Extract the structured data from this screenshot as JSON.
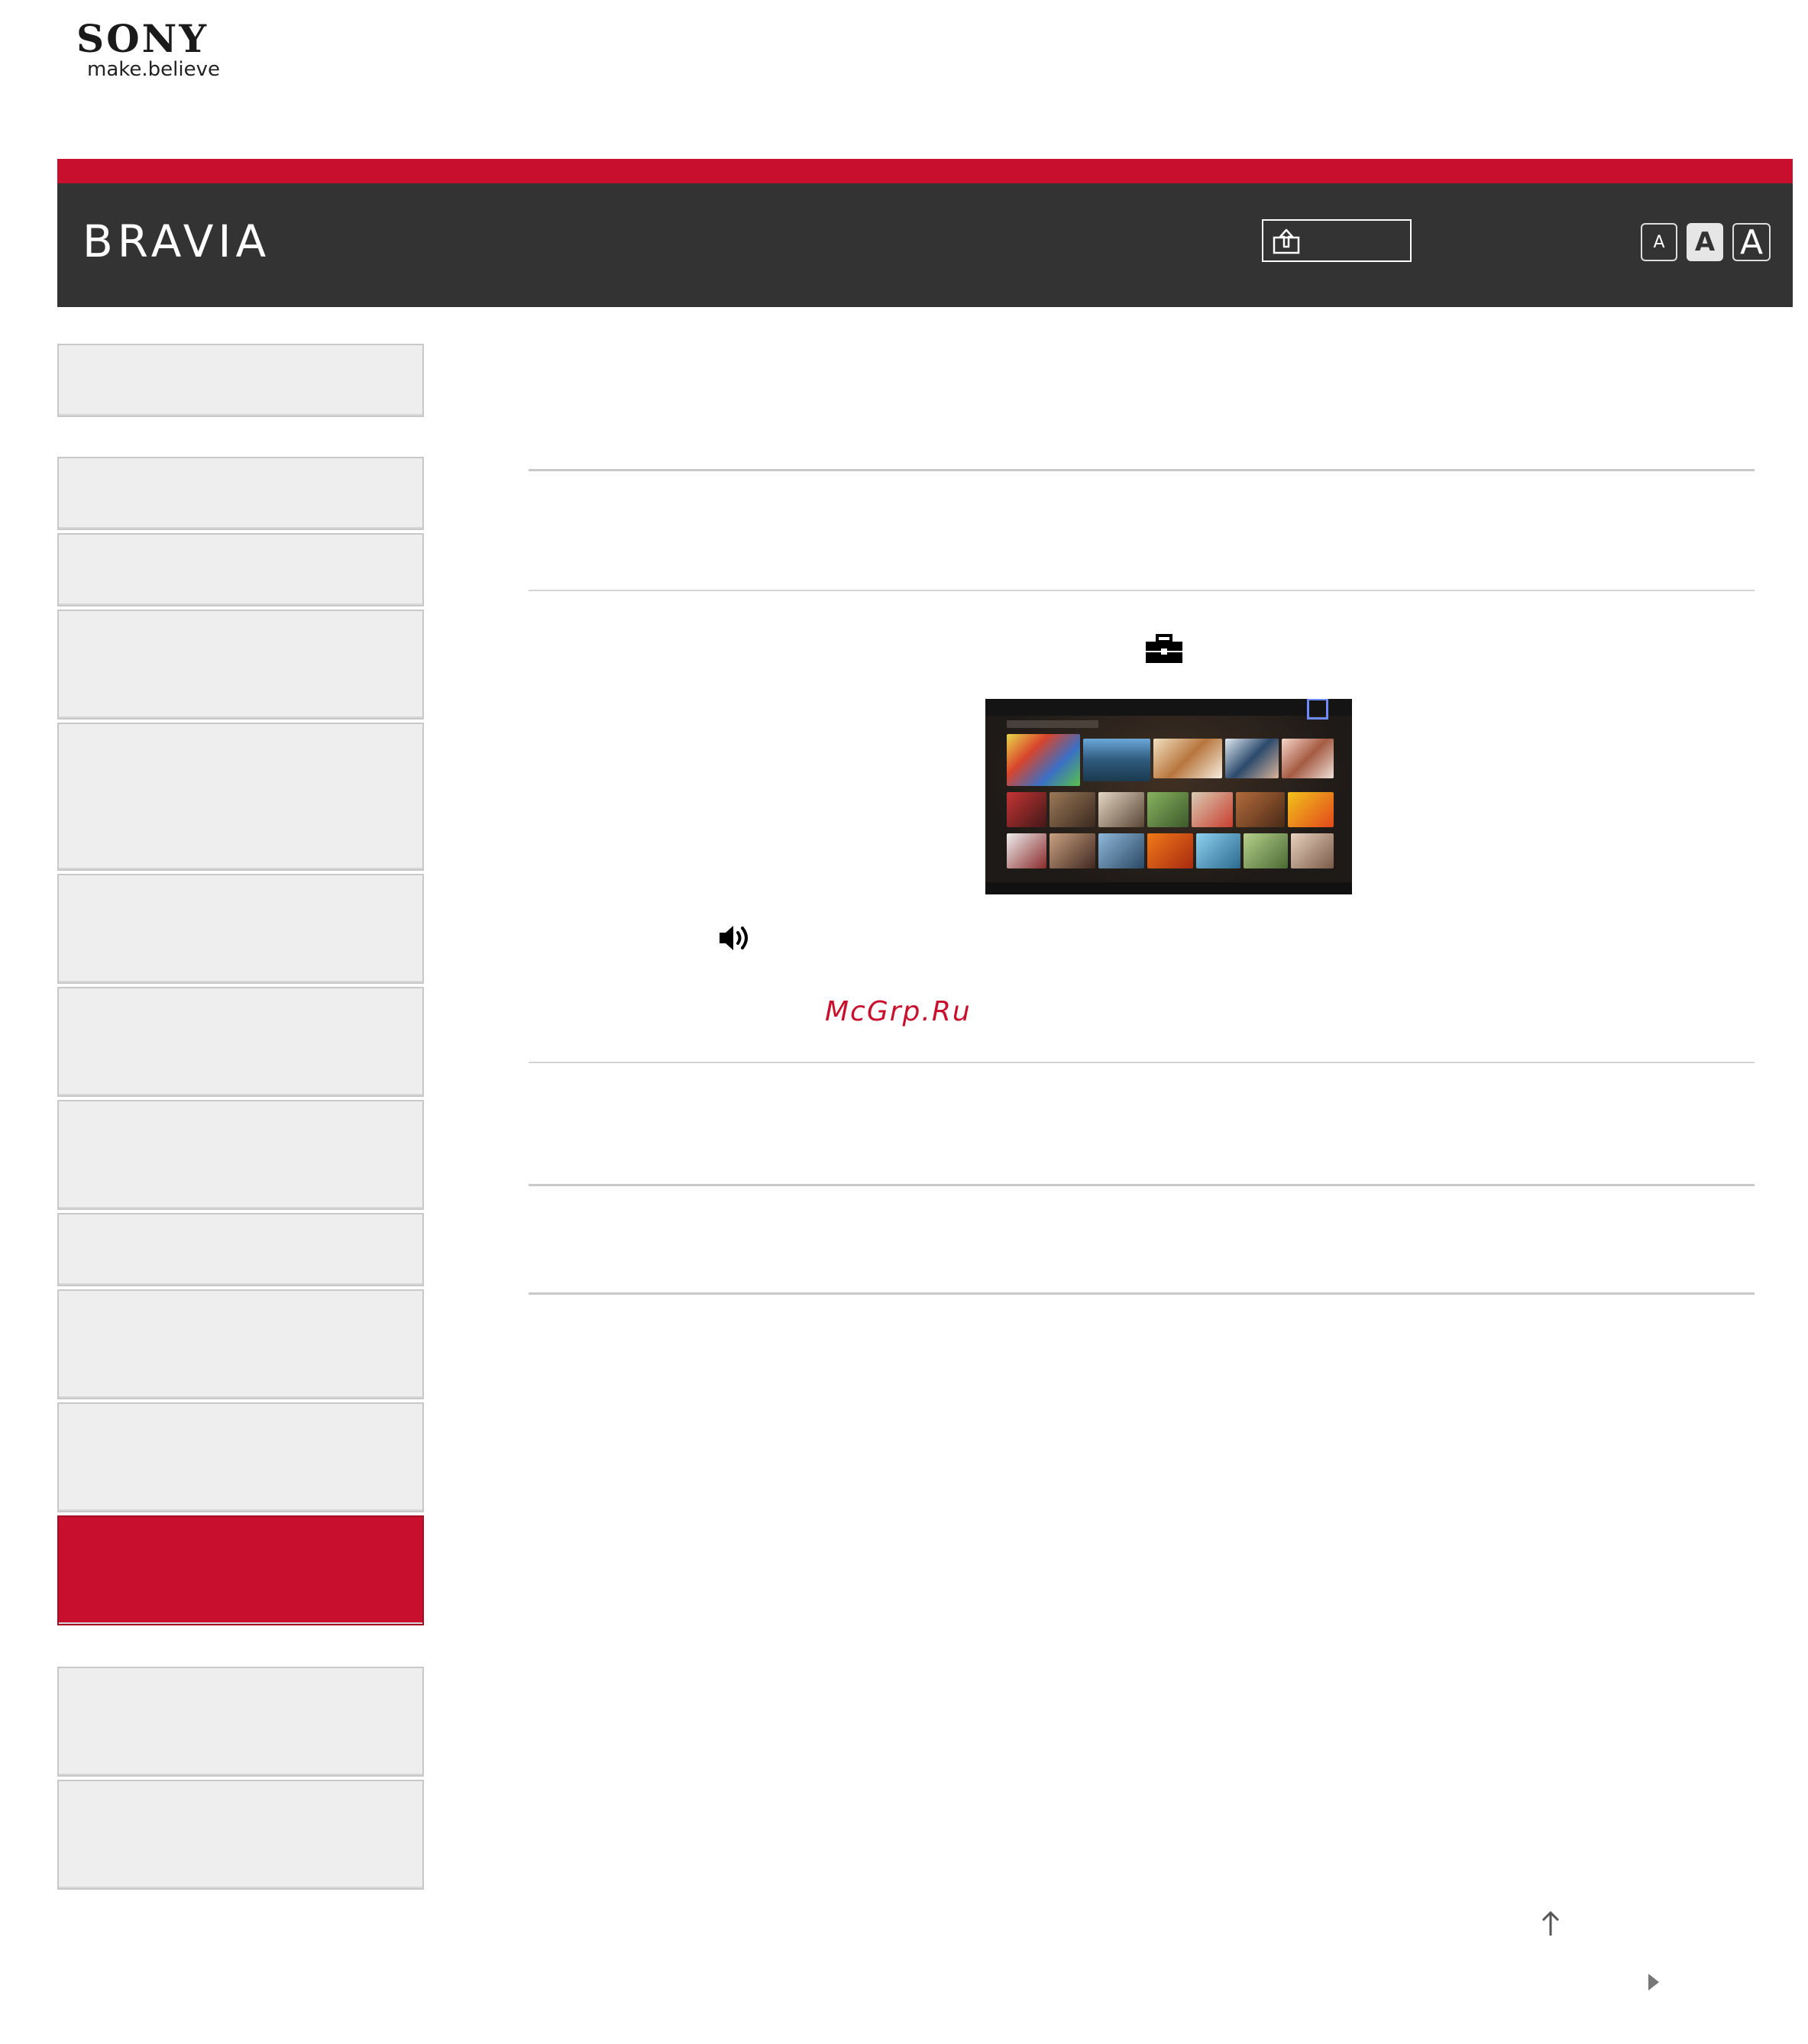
{
  "brand": {
    "name": "SONY",
    "tagline": "make.believe"
  },
  "header": {
    "title": "BRAVIA",
    "print_label": "",
    "font_size_buttons": [
      "A",
      "A",
      "A"
    ]
  },
  "sidebar": {
    "items": [
      {
        "label": ""
      },
      {
        "label": ""
      },
      {
        "label": ""
      },
      {
        "label": ""
      },
      {
        "label": ""
      },
      {
        "label": ""
      },
      {
        "label": ""
      },
      {
        "label": ""
      },
      {
        "label": ""
      },
      {
        "label": ""
      },
      {
        "label": ""
      },
      {
        "label": ""
      },
      {
        "label": ""
      },
      {
        "label": ""
      }
    ],
    "active_index": 11
  },
  "content": {
    "watermark": "McGrp.Ru"
  },
  "icons": {
    "toolbox": "toolbox-icon",
    "speaker": "speaker-icon",
    "print": "print-icon",
    "back_to_top": "arrow-up-icon",
    "next_page": "triangle-right-icon"
  },
  "colors": {
    "accent_red": "#c8102e",
    "header_dark": "#333333",
    "sidebar_bg": "#eeeeee"
  }
}
